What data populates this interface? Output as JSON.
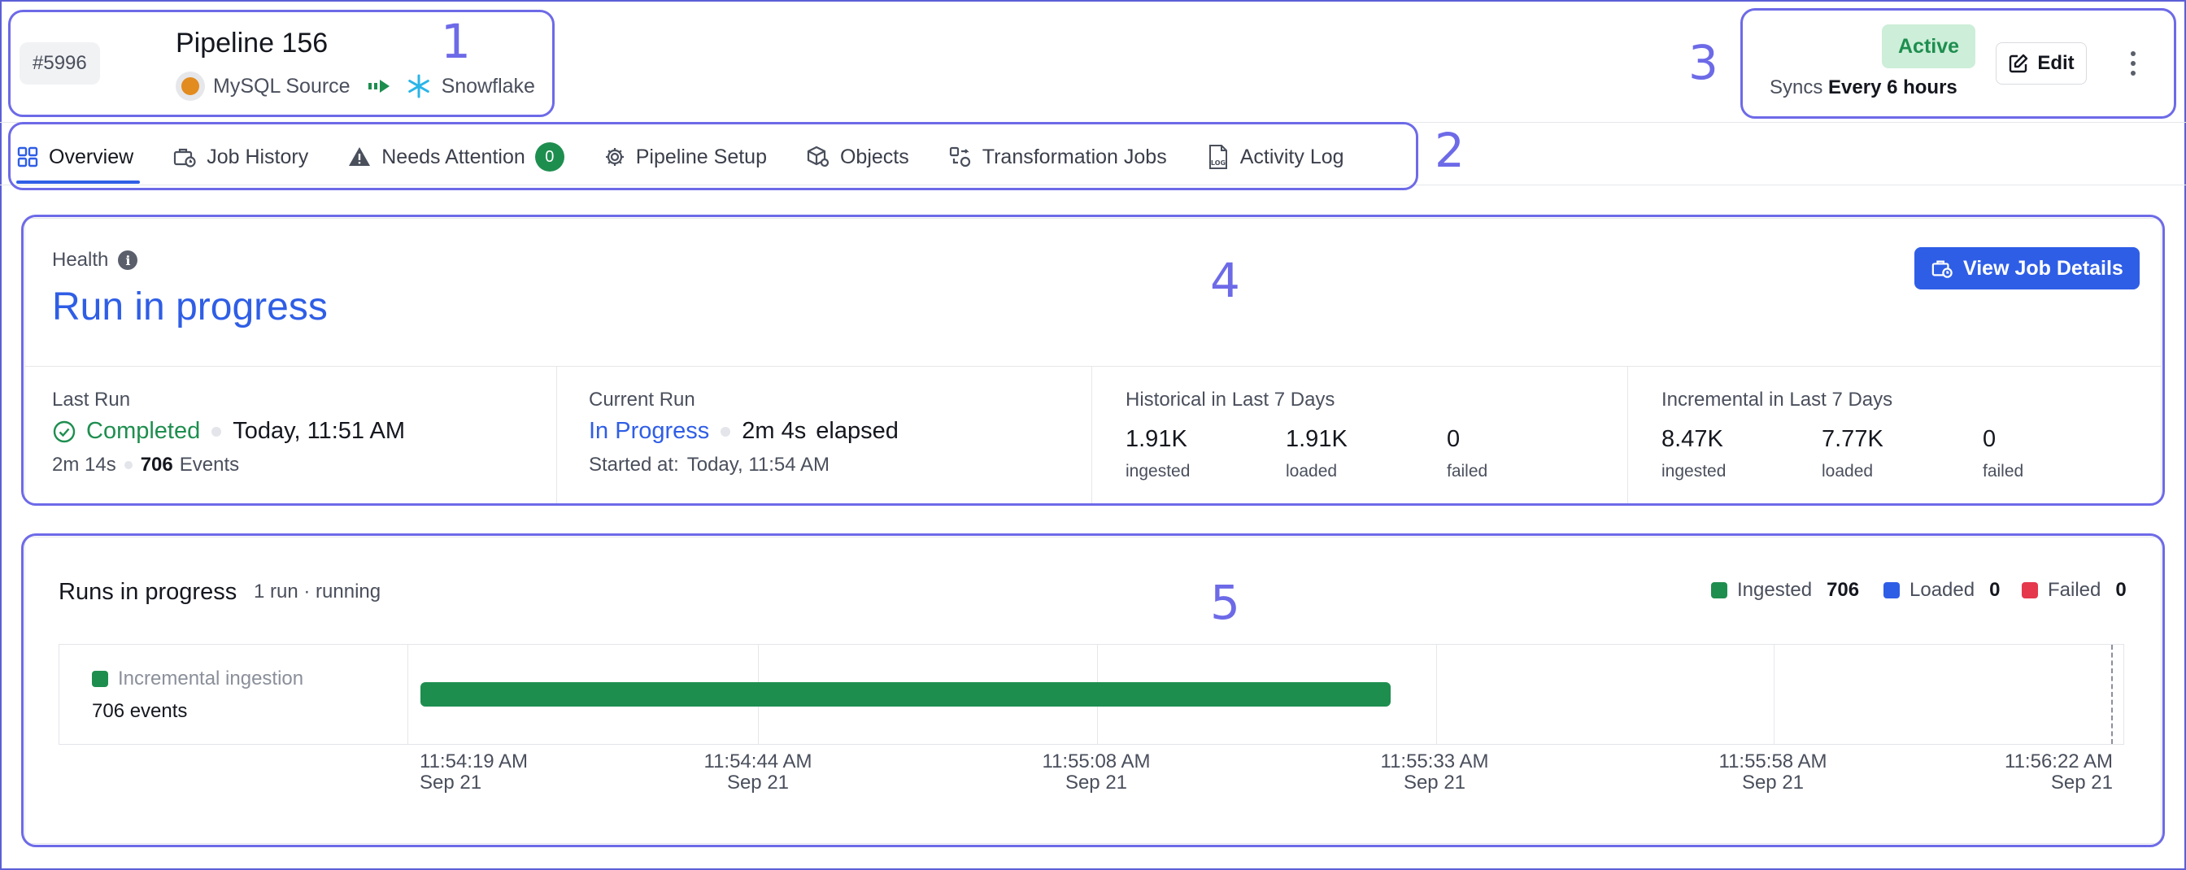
{
  "header": {
    "pipeline_id": "#5996",
    "pipeline_name": "Pipeline 156",
    "source": "MySQL Source",
    "destination": "Snowflake",
    "status": "Active",
    "syncs_label": "Syncs",
    "syncs_value": "Every 6 hours",
    "edit_label": "Edit"
  },
  "tabs": [
    {
      "label": "Overview",
      "icon": "grid-icon",
      "active": true
    },
    {
      "label": "Job History",
      "icon": "briefcase-clock-icon"
    },
    {
      "label": "Needs Attention",
      "icon": "warning-icon",
      "count": "0"
    },
    {
      "label": "Pipeline Setup",
      "icon": "gear-icon"
    },
    {
      "label": "Objects",
      "icon": "cube-gear-icon"
    },
    {
      "label": "Transformation Jobs",
      "icon": "transform-icon"
    },
    {
      "label": "Activity Log",
      "icon": "log-file-icon"
    }
  ],
  "health": {
    "label": "Health",
    "status": "Run in progress",
    "view_button": "View Job Details"
  },
  "last_run": {
    "label": "Last Run",
    "status": "Completed",
    "time": "Today, 11:51 AM",
    "duration": "2m 14s",
    "events_count": "706",
    "events_label": "Events"
  },
  "current_run": {
    "label": "Current Run",
    "status": "In Progress",
    "elapsed_value": "2m 4s",
    "elapsed_label": "elapsed",
    "started_label": "Started at:",
    "started_value": "Today, 11:54 AM"
  },
  "historical": {
    "label": "Historical in Last 7 Days",
    "ingested": "1.91K",
    "loaded": "1.91K",
    "failed": "0",
    "ingested_label": "ingested",
    "loaded_label": "loaded",
    "failed_label": "failed"
  },
  "incremental": {
    "label": "Incremental in Last 7 Days",
    "ingested": "8.47K",
    "loaded": "7.77K",
    "failed": "0",
    "ingested_label": "ingested",
    "loaded_label": "loaded",
    "failed_label": "failed"
  },
  "runs": {
    "title": "Runs in progress",
    "subtitle": "1 run · running",
    "legend": [
      {
        "label": "Ingested",
        "value": "706",
        "color": "#1e8e4f"
      },
      {
        "label": "Loaded",
        "value": "0",
        "color": "#2f5ee6"
      },
      {
        "label": "Failed",
        "value": "0",
        "color": "#e5384d"
      }
    ],
    "row_label": "Incremental ingestion",
    "row_count": "706 events",
    "ingestion_progress_fraction": 0.574,
    "ticks": [
      {
        "time": "11:54:19 AM",
        "date": "Sep 21"
      },
      {
        "time": "11:54:44 AM",
        "date": "Sep 21"
      },
      {
        "time": "11:55:08 AM",
        "date": "Sep 21"
      },
      {
        "time": "11:55:33 AM",
        "date": "Sep 21"
      },
      {
        "time": "11:55:58 AM",
        "date": "Sep 21"
      },
      {
        "time": "11:56:22 AM",
        "date": "Sep 21"
      }
    ]
  },
  "annotations": [
    "1",
    "2",
    "3",
    "4",
    "5"
  ],
  "colors": {
    "accent": "#2f5ee6",
    "success": "#1e8e4f",
    "active_badge_bg": "#cdeed8",
    "annotation": "#6d6ae8"
  }
}
